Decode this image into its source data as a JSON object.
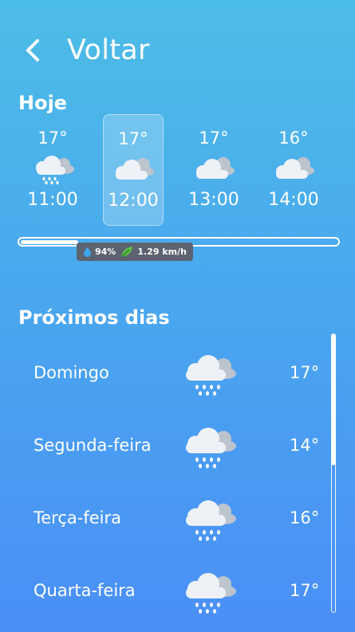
{
  "header": {
    "back_label": "Voltar",
    "back_icon": "chevron-left-icon"
  },
  "today": {
    "title": "Hoje",
    "hours": [
      {
        "temp": "17°",
        "time": "11:00",
        "icon": "rain-cloud-icon",
        "selected": false
      },
      {
        "temp": "17°",
        "time": "12:00",
        "icon": "cloud-icon",
        "selected": true
      },
      {
        "temp": "17°",
        "time": "13:00",
        "icon": "cloud-icon",
        "selected": false
      },
      {
        "temp": "16°",
        "time": "14:00",
        "icon": "cloud-icon",
        "selected": false
      }
    ],
    "timeline_progress": 0.18,
    "details": {
      "humidity": "94%",
      "wind": "1.29 km/h",
      "humidity_icon": "droplet-icon",
      "wind_icon": "leaf-icon"
    }
  },
  "next_days": {
    "title": "Próximos dias",
    "days": [
      {
        "name": "Domingo",
        "temp": "17°",
        "icon": "rain-cloud-icon"
      },
      {
        "name": "Segunda-feira",
        "temp": "14°",
        "icon": "rain-cloud-icon"
      },
      {
        "name": "Terça-feira",
        "temp": "16°",
        "icon": "rain-cloud-icon"
      },
      {
        "name": "Quarta-feira",
        "temp": "17°",
        "icon": "rain-cloud-icon"
      }
    ]
  },
  "colors": {
    "badge_bg": "#5c6370",
    "cloud_front": "#eef2f7",
    "cloud_back": "#bcc4cd",
    "rain": "#ffffff"
  }
}
